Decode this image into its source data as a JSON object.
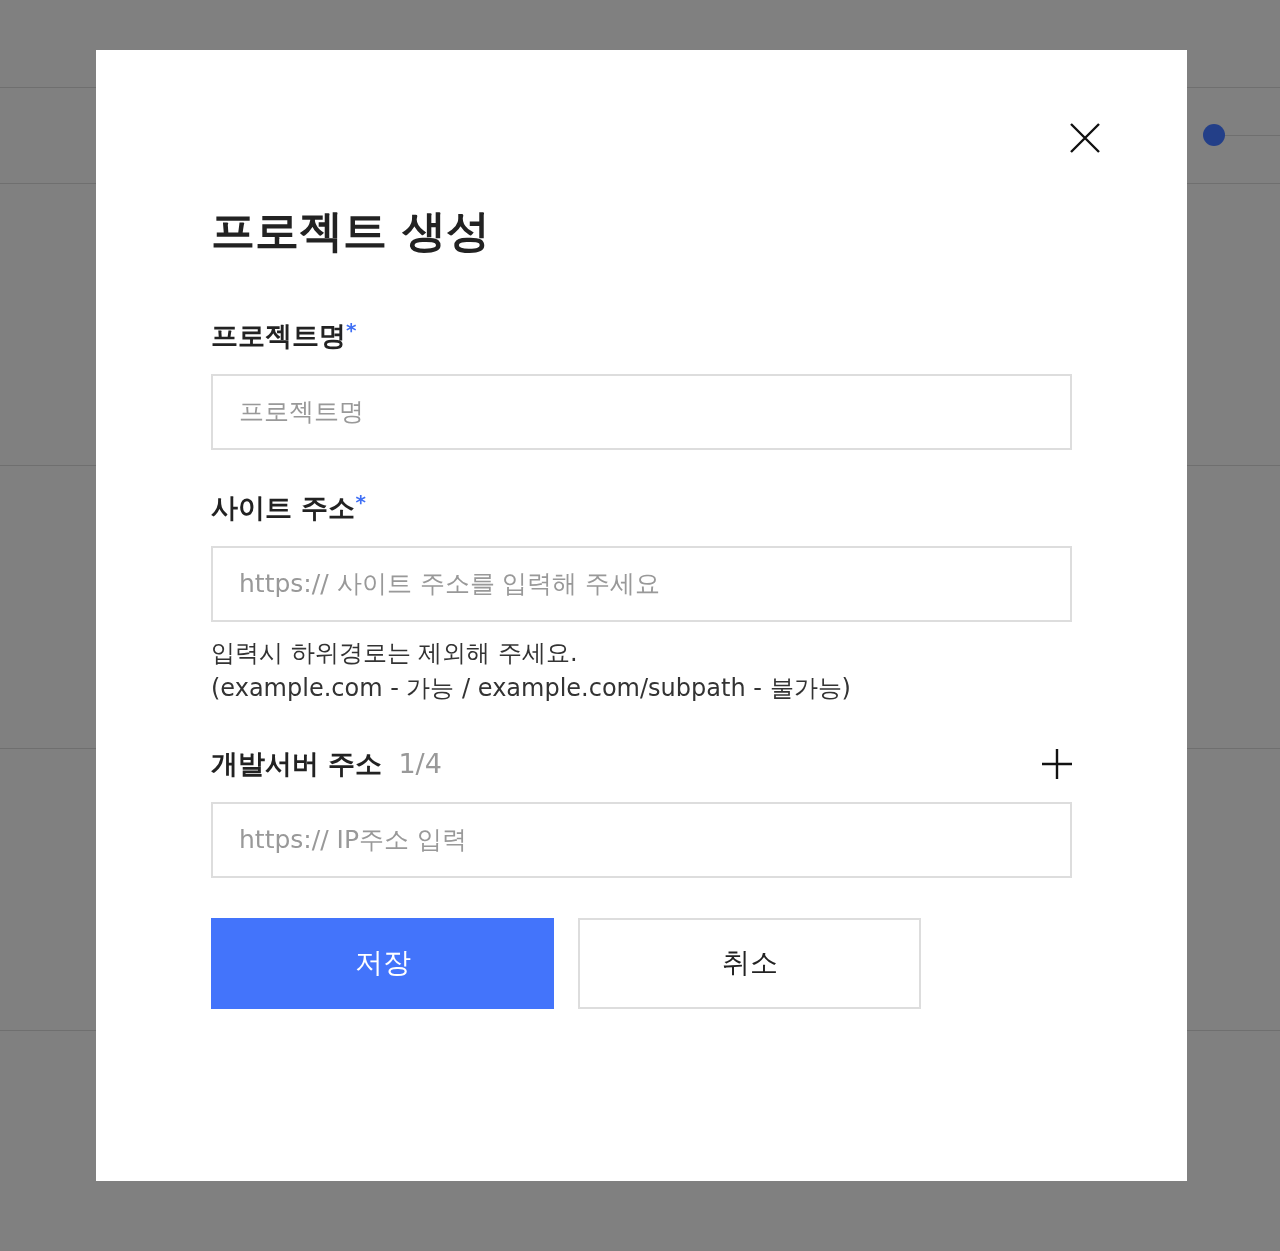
{
  "dialog": {
    "title": "프로젝트 생성",
    "fields": [
      {
        "label": "프로젝트명",
        "required_mark": "*",
        "placeholder": "프로젝트명"
      },
      {
        "label": "사이트 주소",
        "required_mark": "*",
        "placeholder": "https:// 사이트 주소를 입력해 주세요",
        "help": [
          "입력시 하위경로는 제외해 주세요.",
          "(example.com - 가능 / example.com/subpath - 불가능)"
        ]
      },
      {
        "label": "개발서버 주소",
        "counter": "1/4",
        "addable": true,
        "placeholder": "https:// IP주소 입력"
      }
    ],
    "buttons": [
      {
        "label": "저장",
        "kind": "primary"
      },
      {
        "label": "취소",
        "kind": "secondary"
      }
    ]
  }
}
